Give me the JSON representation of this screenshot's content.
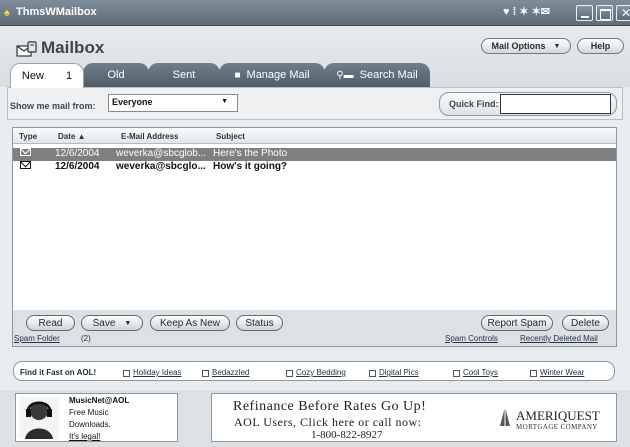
{
  "window": {
    "title": "ThmsWMailbox"
  },
  "header": {
    "title": "Mailbox",
    "mail_options": "Mail Options",
    "help": "Help"
  },
  "tabs": [
    {
      "label": "New",
      "count": "1"
    },
    {
      "label": "Old"
    },
    {
      "label": "Sent"
    },
    {
      "label": "Manage Mail"
    },
    {
      "label": "Search Mail"
    }
  ],
  "filter": {
    "label": "Show me mail from:",
    "value": "Everyone",
    "quick_find_label": "Quick Find:",
    "quick_find_value": ""
  },
  "columns": {
    "type": "Type",
    "date": "Date ▲",
    "email": "E-Mail Address",
    "subject": "Subject"
  },
  "messages": [
    {
      "date": "12/6/2004",
      "email": "weverka@sbcglob...",
      "subject": "Here's the Photo",
      "selected": true,
      "unread": false
    },
    {
      "date": "12/6/2004",
      "email": "weverka@sbcglo...",
      "subject": "How's it going?",
      "selected": false,
      "unread": true
    }
  ],
  "actions": {
    "read": "Read",
    "save": "Save",
    "keep_as_new": "Keep As New",
    "status": "Status",
    "report_spam": "Report Spam",
    "delete": "Delete"
  },
  "links": {
    "spam_folder": "Spam Folder",
    "spam_folder_count": "(2)",
    "spam_controls": "Spam Controls",
    "recently_deleted": "Recently Deleted Mail"
  },
  "find_fast": {
    "title": "Find it Fast on AOL!",
    "items": [
      "Holiday Ideas",
      "Bedazzled",
      "Cozy Bedding",
      "Digital Pics",
      "Cool Toys",
      "Winter Wear"
    ]
  },
  "ad_music": {
    "title": "MusicNet@AOL",
    "line1": "Free Music",
    "line2": "Downloads.",
    "line3": "It's legal!"
  },
  "ad_refi": {
    "line1": "Refinance Before Rates Go Up!",
    "line2": "AOL Users, Click here or call now:",
    "line3": "1-800-822-8927",
    "brand": "AMERIQUEST",
    "brand_sub": "MORTGAGE COMPANY"
  },
  "colors": {
    "titlebar": "#6b7986",
    "tab": "#5f6d78",
    "selected_row": "#7f7f7f",
    "header_bg": "#e1e5e8"
  }
}
